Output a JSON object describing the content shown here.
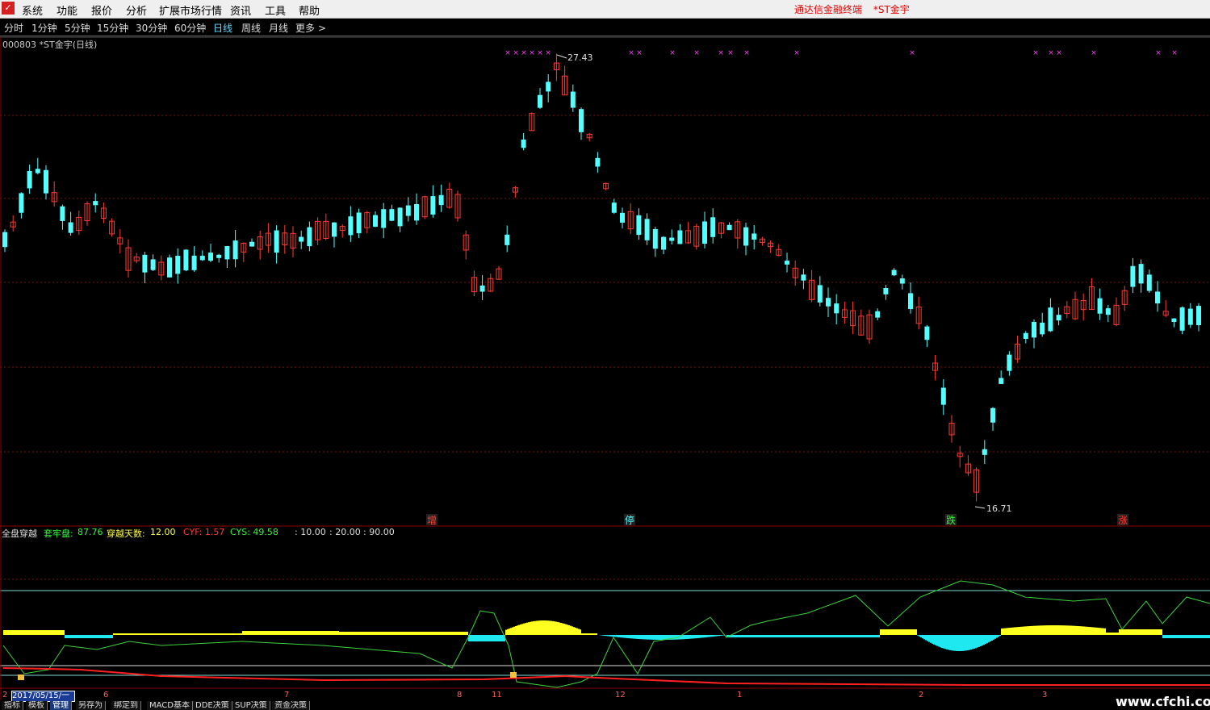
{
  "menu": {
    "items": [
      "系统",
      "功能",
      "报价",
      "分析",
      "扩展市场行情",
      "资讯",
      "工具",
      "帮助"
    ],
    "brand": "通达信金融终端",
    "stock": "*ST金宇"
  },
  "periods": {
    "items": [
      "分时",
      "1分钟",
      "5分钟",
      "15分钟",
      "30分钟",
      "60分钟",
      "日线",
      "周线",
      "月线",
      "更多 >"
    ],
    "active": "日线"
  },
  "chart": {
    "title": "000803 *ST金宇(日线)",
    "high_label": "27.43",
    "low_label": "16.71",
    "markers": [
      "增",
      "停",
      "跌",
      "涨"
    ],
    "colors": {
      "up": "#ff3b30",
      "down": "#54ffff",
      "ma_line": "#ff2020",
      "grid": "#7a1414",
      "cross": "#ff40ff"
    }
  },
  "indicator": {
    "name": "全盘穿越",
    "tao_label": "套牢盘:",
    "tao_value": "87.76",
    "days_label": "穿越天数:",
    "days_value": "12.00",
    "cyf": "CYF: 1.57",
    "cys": "CYS: 49.58",
    "levels": [
      ": 10.00",
      ": 20.00",
      ": 90.00"
    ]
  },
  "axis": {
    "date_box": "2017/05/15/一",
    "first": "2",
    "months": [
      "6",
      "7",
      "8",
      "11",
      "12",
      "1",
      "2",
      "3"
    ]
  },
  "tabs": [
    "指标",
    "模板",
    "管理",
    "另存为",
    "绑定到",
    "MACD基本",
    "DDE决策",
    "SUP决策",
    "资金决策"
  ],
  "active_tab": "管理",
  "watermark": "www.cfchi.com"
}
